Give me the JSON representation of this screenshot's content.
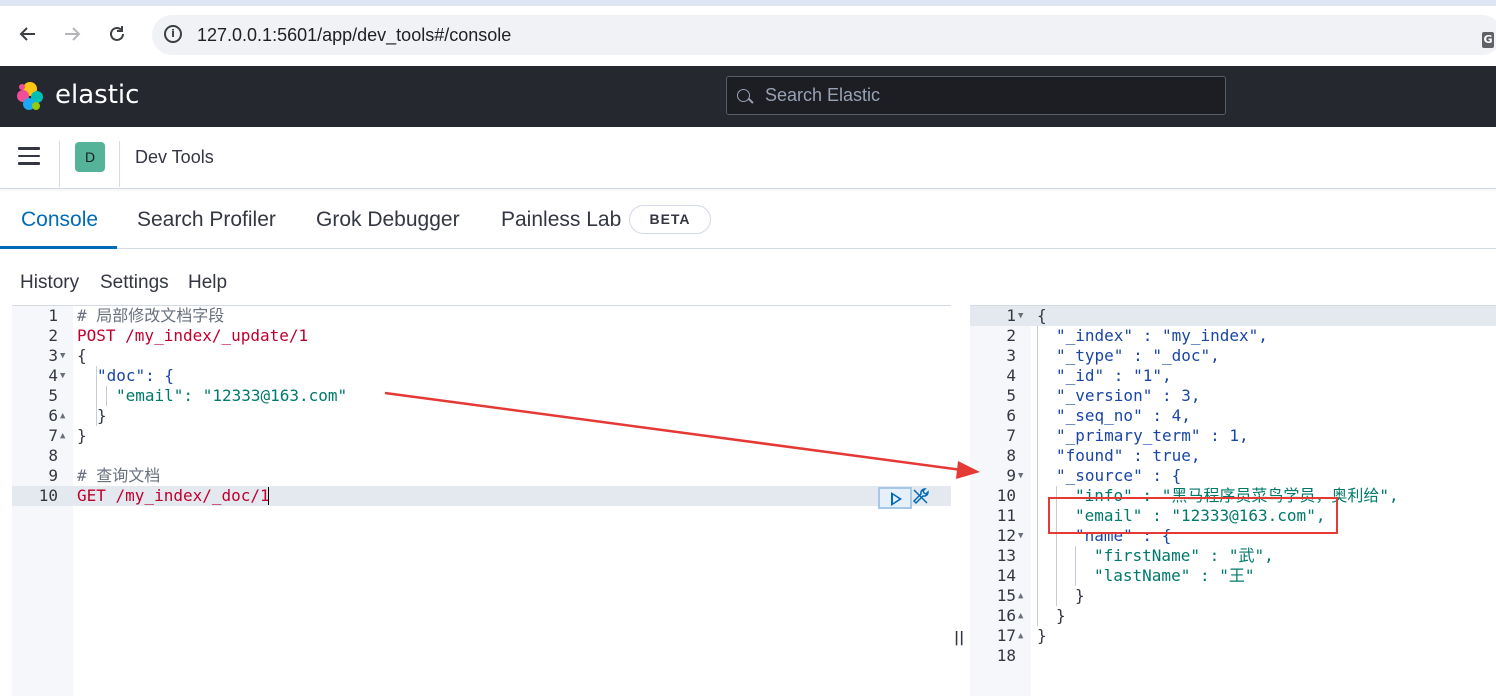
{
  "browser": {
    "url": "127.0.0.1:5601/app/dev_tools#/console",
    "back_icon": "arrow-left-icon",
    "forward_icon": "arrow-right-icon",
    "reload_icon": "reload-icon",
    "info_icon": "i"
  },
  "header": {
    "brand": "elastic",
    "search_placeholder": "Search Elastic"
  },
  "app_bar": {
    "space_initial": "D",
    "breadcrumb": "Dev Tools"
  },
  "tabs": [
    {
      "label": "Console",
      "active": true
    },
    {
      "label": "Search Profiler",
      "active": false
    },
    {
      "label": "Grok Debugger",
      "active": false
    },
    {
      "label": "Painless Lab",
      "active": false
    }
  ],
  "beta_badge": "BETA",
  "console_menu": [
    "History",
    "Settings",
    "Help"
  ],
  "request_lines": [
    {
      "n": "1",
      "text": "# 局部修改文档字段"
    },
    {
      "n": "2",
      "text": "POST /my_index/_update/1"
    },
    {
      "n": "3",
      "text": "{"
    },
    {
      "n": "4",
      "text": "\"doc\": {"
    },
    {
      "n": "5",
      "text": "\"email\": \"12333@163.com\""
    },
    {
      "n": "6",
      "text": "}"
    },
    {
      "n": "7",
      "text": "}"
    },
    {
      "n": "8",
      "text": ""
    },
    {
      "n": "9",
      "text": "# 查询文档"
    },
    {
      "n": "10",
      "text": "GET /my_index/_doc/1"
    }
  ],
  "response_lines": [
    {
      "n": "1",
      "text": "{"
    },
    {
      "n": "2",
      "text": "\"_index\" : \"my_index\","
    },
    {
      "n": "3",
      "text": "\"_type\" : \"_doc\","
    },
    {
      "n": "4",
      "text": "\"_id\" : \"1\","
    },
    {
      "n": "5",
      "text": "\"_version\" : 3,"
    },
    {
      "n": "6",
      "text": "\"_seq_no\" : 4,"
    },
    {
      "n": "7",
      "text": "\"_primary_term\" : 1,"
    },
    {
      "n": "8",
      "text": "\"found\" : true,"
    },
    {
      "n": "9",
      "text": "\"_source\" : {"
    },
    {
      "n": "10",
      "text": "\"info\" : \"黑马程序员菜鸟学员，奥利给\","
    },
    {
      "n": "11",
      "text": "\"email\" : \"12333@163.com\","
    },
    {
      "n": "12",
      "text": "\"name\" : {"
    },
    {
      "n": "13",
      "text": "\"firstName\" : \"武\","
    },
    {
      "n": "14",
      "text": "\"lastName\" : \"王\""
    },
    {
      "n": "15",
      "text": "}"
    },
    {
      "n": "16",
      "text": "}"
    },
    {
      "n": "17",
      "text": "}"
    },
    {
      "n": "18",
      "text": ""
    }
  ],
  "colors": {
    "accent": "#006bb8",
    "header_bg": "#25282f",
    "annotation": "#e53935"
  }
}
